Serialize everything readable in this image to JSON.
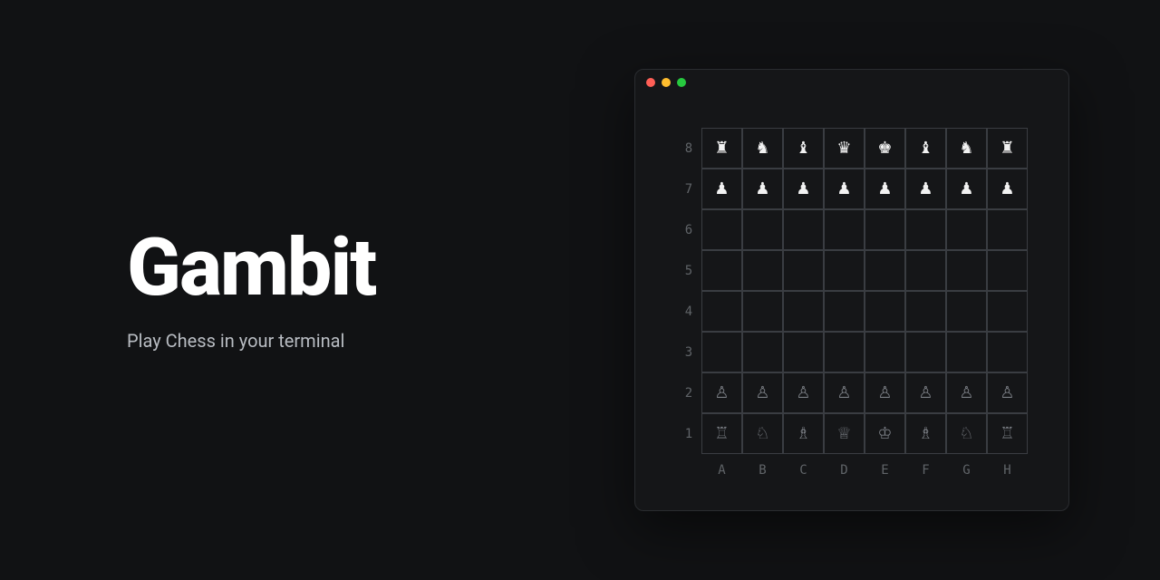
{
  "title": "Gambit",
  "subtitle": "Play Chess in your terminal",
  "board": {
    "ranks": [
      "8",
      "7",
      "6",
      "5",
      "4",
      "3",
      "2",
      "1"
    ],
    "files": [
      "A",
      "B",
      "C",
      "D",
      "E",
      "F",
      "G",
      "H"
    ],
    "glyph_map": {
      "R": "♜",
      "N": "♞",
      "B": "♝",
      "Q": "♛",
      "K": "♚",
      "P": "♟",
      "r": "♖",
      "n": "♘",
      "b": "♗",
      "q": "♕",
      "k": "♔",
      "p": "♙",
      "": ""
    },
    "solid_pieces": [
      "R",
      "N",
      "B",
      "Q",
      "K",
      "P"
    ],
    "cells": [
      [
        "R",
        "N",
        "B",
        "Q",
        "K",
        "B",
        "N",
        "R"
      ],
      [
        "P",
        "P",
        "P",
        "P",
        "P",
        "P",
        "P",
        "P"
      ],
      [
        "",
        "",
        "",
        "",
        "",
        "",
        "",
        ""
      ],
      [
        "",
        "",
        "",
        "",
        "",
        "",
        "",
        ""
      ],
      [
        "",
        "",
        "",
        "",
        "",
        "",
        "",
        ""
      ],
      [
        "",
        "",
        "",
        "",
        "",
        "",
        "",
        ""
      ],
      [
        "p",
        "p",
        "p",
        "p",
        "p",
        "p",
        "p",
        "p"
      ],
      [
        "r",
        "n",
        "b",
        "q",
        "k",
        "b",
        "n",
        "r"
      ]
    ]
  }
}
